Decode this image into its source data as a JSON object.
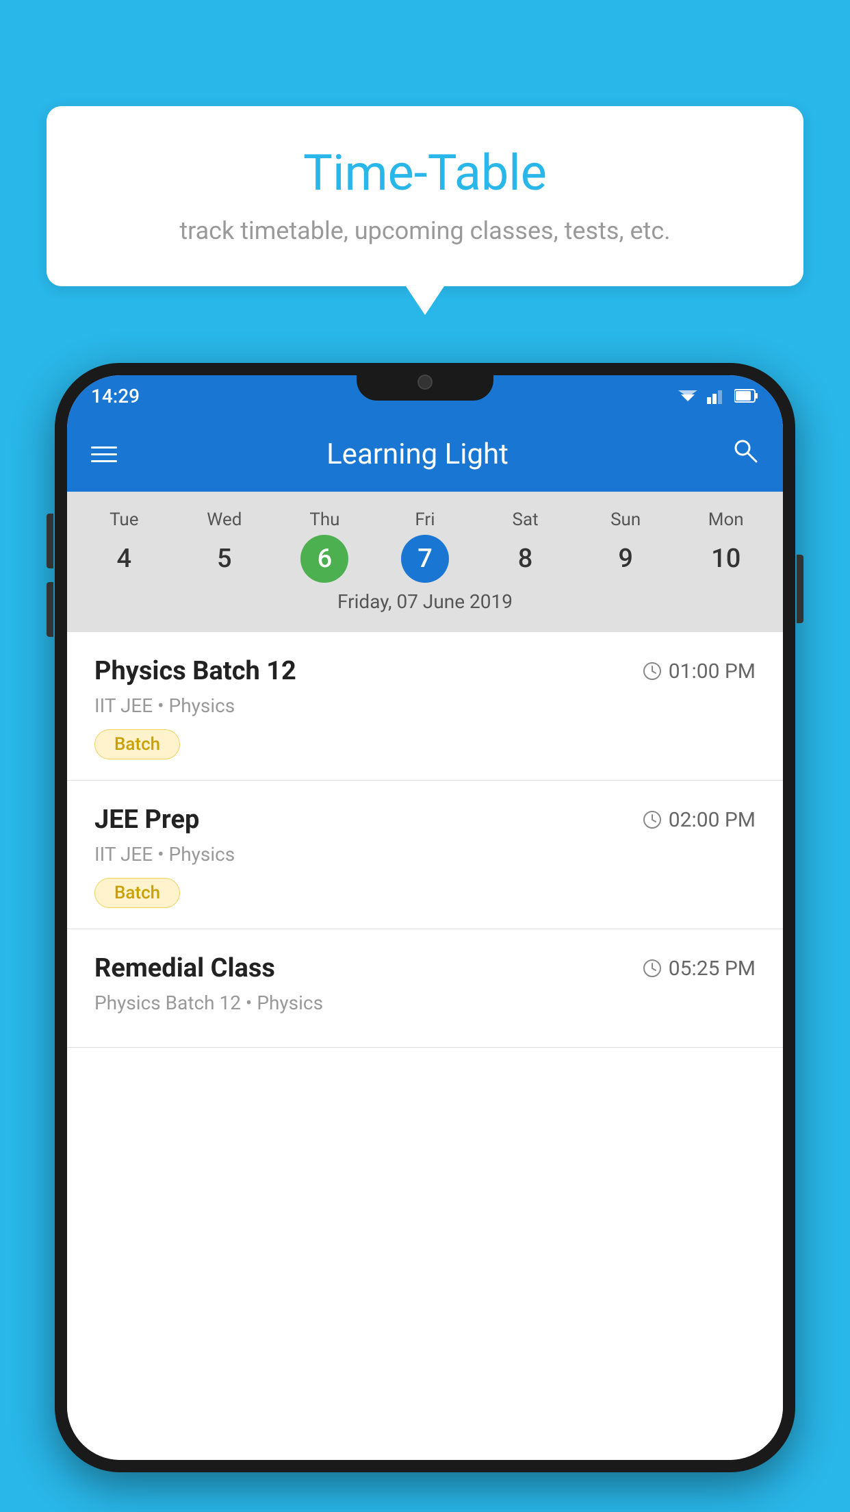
{
  "background_color": "#29b6e8",
  "tooltip": {
    "title": "Time-Table",
    "subtitle": "track timetable, upcoming classes, tests, etc."
  },
  "app": {
    "status_bar": {
      "time": "14:29"
    },
    "app_bar": {
      "title": "Learning Light"
    },
    "calendar": {
      "days": [
        {
          "label": "Tue",
          "number": "4"
        },
        {
          "label": "Wed",
          "number": "5"
        },
        {
          "label": "Thu",
          "number": "6",
          "state": "today"
        },
        {
          "label": "Fri",
          "number": "7",
          "state": "selected"
        },
        {
          "label": "Sat",
          "number": "8"
        },
        {
          "label": "Sun",
          "number": "9"
        },
        {
          "label": "Mon",
          "number": "10"
        }
      ],
      "selected_date": "Friday, 07 June 2019"
    },
    "classes": [
      {
        "name": "Physics Batch 12",
        "time": "01:00 PM",
        "meta": "IIT JEE • Physics",
        "badge": "Batch"
      },
      {
        "name": "JEE Prep",
        "time": "02:00 PM",
        "meta": "IIT JEE • Physics",
        "badge": "Batch"
      },
      {
        "name": "Remedial Class",
        "time": "05:25 PM",
        "meta": "Physics Batch 12 • Physics",
        "badge": null
      }
    ]
  },
  "icons": {
    "hamburger": "≡",
    "search": "🔍",
    "clock": "🕐"
  }
}
